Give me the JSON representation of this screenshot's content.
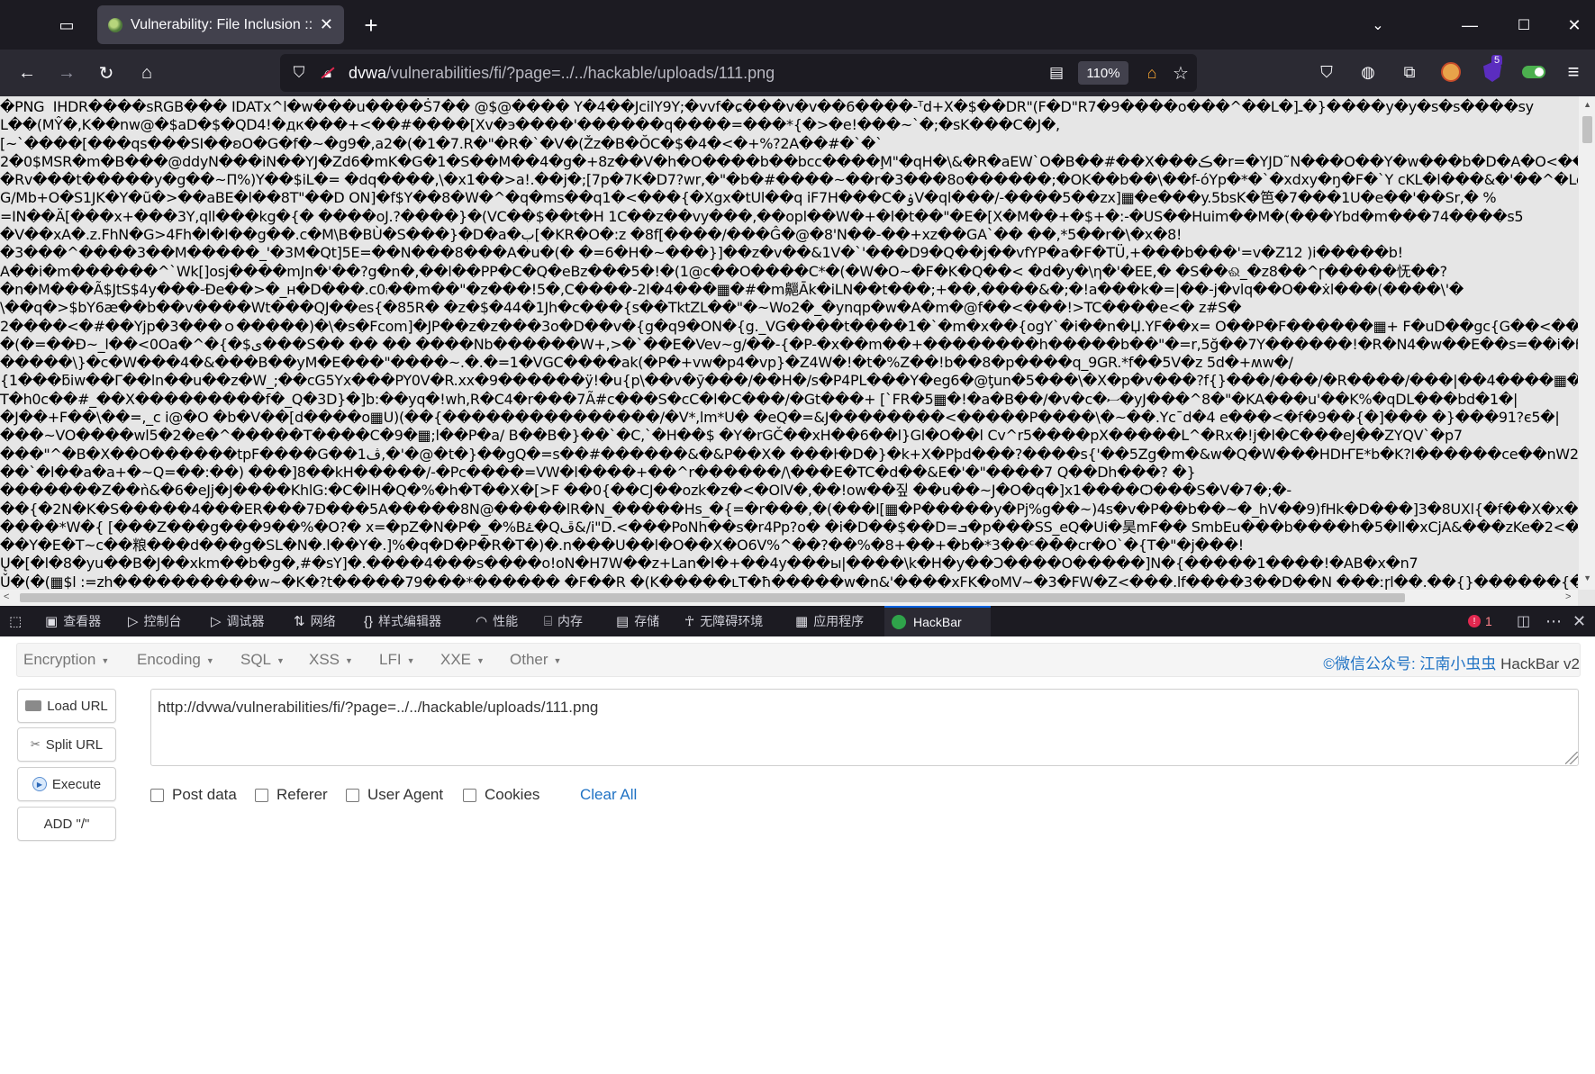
{
  "tab": {
    "title": "Vulnerability: File Inclusion ::",
    "close": "✕",
    "new_tab": "+"
  },
  "window": {
    "overflow": "⌄",
    "minimize": "—",
    "maximize": "☐",
    "close": "✕"
  },
  "nav": {
    "url_host": "dvwa",
    "url_path": "/vulnerabilities/fi/?page=../../hackable/uploads/111.png",
    "zoom": "110%",
    "ublock_badge": "5"
  },
  "icons": {
    "tab_list": "tab-list-icon",
    "back": "back-arrow-icon",
    "forward": "forward-arrow-icon",
    "reload": "reload-icon",
    "home": "home-icon",
    "shield": "tracking-shield-icon",
    "lock": "insecure-lock-icon",
    "reader": "reader-view-icon",
    "star": "bookmark-star-icon",
    "pocket": "pocket-icon",
    "globe": "globe-icon",
    "extensions": "puzzle-icon",
    "menu": "hamburger-menu-icon"
  },
  "page_lines": [
    "�PNG  IHDR����sRGB��� IDATx^l�w���u����Ṡ7�� @$@���� Y�4��JcilY9Y;�vvf�ɕ���v�v��6����-ᵀd+X�$��DR\"(F�D\"R7�9����o���^��L�]ـ�}����y�y�s�s����sy",
    "L��(MŶ�,K��nw@�$aD�$�QD4!�дк���+<��#����[Xv�э����'������q����=���*{�>�e!���~`�;�sK���C�J�,",
    "[~`����[���qs���SI��ʚO�G�f�~�g9�,a2�(�1�7.R�\"�R�`�V�(Žz�B�ŎC�$�4�<�+%?2A��#�`�`",
    "2�0$MSR�m�B���@ddyN���iN��YJ�Zd6�mK�G�1�S��M��4�g�+8z��V�h�O����b��bcc����M̧\"�qH�\\&�R�aEW`O�B��#��X���ڪ�r=�YJD˜N���O��Y�w���b�D�A�O<��p~i���",
    "�Rv���t�����y�g��~Π%)Y��$iL�= �dq����,\\�x1��>a!.��j�;[7p�7K�D7?wr,�\"�b�#����~��r�3���8o������;�OK��b��\\��f-óYp�*�`�xdxy�ŋ�F�`Y cKL�l���&�'��^�Le}",
    "G/Mb+O�S1JK�Y�ũ�>��aBE�l��8T\"��D ON]�f$Y��8�W�^�q�ms��q1�<���{�Xgx�tUl��q iF7H���C�ۏV�ql���/-����5��zx]▦�e���y.5ƅsK�笆�7���1U�e��'��Sr,� %",
    "=IN��Ä[���x+���3Y,qll���kg�{� ����oJ.?����}�(VC��$��t�H 1C��z��vy���,��opl��W�+�l�t��\"�E�[X�M��+�$+�:-�US��Huim��M�(���Ybd�m���74����s5",
    "�V��xA�.z.FhN�G>4Fh�l�l��g��.c�M\\B�BÙ�S���}�D�a�ب[�KR�O�:z �8f[����/���Ĝ�@�8'N��-��+xz��GA`�� ��,*5��r�\\�x�8!",
    "�3���^����3��M�����_'�3M�Qt]5E=��N���8���A�u�(� �=6�H�~���}]��z�v��&1V�`'���D9�Q��j��vfYP�a�F�TÜ,+���b���'=v�Z12 )i�����b!",
    "A��i�m������^`Wk[]osj����mJn�'��?g�n�,��l��PP�C�Q�eBz���5�!�(1@c��O����C*�(�W�O~�F�K�Q��< �d�y�\\η�'�EE,� �S��ଈ_�z8��^ɼ�����怃��?",
    "�n�M���Ã$JtS$4y���-Ðe��>�_ʜ�D���.c0ᵢ��m��\"�z���!5�,C����-2l�4���▦�#�m齆Āk�iLN��t���;+��,����&�;�!a���k�=|��-j�vlq��O��ẋl���(����\\'�",
    "\\��q�>$bY6æ��b��v����Wt���QJ��es{�85R� �z�$�44�1Jh�c���{s��TktZL��\"�~Wo2�_�ynqp�w�A�m�@f��<���!>TC����e<� z#S�",
    "2����<�#��Yjp�3���ｏ�����)�\\�s�Fcom]�JP��z�z���3o�D��v�{g�q9�ON�{g._VG����t����1�`�m�x��{ogY`�i��n�Џ.YF��x= O��P�F������▦+ F�uD��gc{G��<��9�AH",
    "�(�=��Ð~_l��<0Oa�^�{�$ى���S�� �� �� ����Nb������W+,>�`��E�Vev~g/��-{�P-�x��m��+��������h�����b��\"�=r,5ğ��7Y������!�R�N4�w��E��s=��i�ɦ�|",
    "�����\\}�c�W���4�&���B��yM�E���\"����~.�.�=1�VGC����ak(�P�+vw�p4�vp}�Z4W�!�t�%Z��!b��8�p����q_9GR.*f��5V�z 5d�+ʍw�/",
    "{1���ƃiw��Γ��ln��u��z�W_;��cG5Yx���PY0V�R.xx�9������ӱ!�u{p\\��v�ӯ���/��H�/s�P4PL���Y�eg6�@ƫun�5���\\�X�p�v���?f{}���/���/�R����/���|��4����▦�(N$d��",
    "T�h0c��#_��X���������f�_Q�3D}�]b:��yq�!wh,R�C4�r���7Ã#c���S�cC�l�C���/�Gt���+ [`FR�5▦�!�a�B��/�v�c�ސ�yJ���^8�\"�KA���u'��K%�qDL���bd�1�|",
    "�J��+F��\\��=,_c i@�O �b�V��[d����o▦U)(��{���������������/�V*,lm*U� �eQ�=&J��������<�����P����\\�~��.Ycˉd�4 e���<�f�9��{�]��� �}���91?є5�|",
    "���~VO����wl5�2�e�^�����T����C�9�▦;l��P�a/ B��B�}��`�C,`�H��$ �Y�rGČ��xH��6��l}Gl�O��l Cv^r5����pX�����L^�Rx�!j�l�C���eJ��ZYQV`�p7",
    "���\"^�B�X��O������tpF����G��1ڤ,�'�@�t�}��gQ�=s��#������&�&P��X� ���ŀ�D�}�k+X�Pþd���?����s{'��5Zg�m�&w�Q�W���HDҤE*b�K?l������ce��nW2��",
    "��`�l��a�a+�~Q=��:��) ���]8��kH�����/-�Pc����=VW�l����+��^r������/\\���E�TC�d��&E�'�\"����7 Q��Dh���? �}",
    "�������Z��ǹ&�6�eJj�J����KhlG:�C�lH�Q�%�h�T��X�[>F ��0{��CJ��ozk�z�<�OlV�,��!ow��짚 ��u��~J�O�q�]x1����Ѻ���S�V�7�;�-",
    "��{�2N�K�S�����4���ER���7Ð���5A�����8N@�����lR�N_�����Hs_�{=�r���,�(���l[▦�P�����y�Pj%g��~)4s�v�P��b��~�_hV��9)fHk�D���]3�8UXl{�f��X�x�F��9ڇ|",
    "����*W�{ [���Z���g���9��%�O?� x=�pZ�N�P�_�%Bۓ�Qڦ&/i\"D.<���PoNh��s�r4Pp?o� �i�D��$��D=ܒ�p���SS_eQ�Ui�昊mF�� SmbEu���b����h�5�ll�xCjA&���zKe�2<�L$\\�� e5|",
    "��Y�E�T~c��粮���d���g�SL�N�.l��Y�.]%�q�D�P�R�T�)�.n���U��l�O��X�O6V%^��?��%�8+��+�b�*3��ᶜ���cr�O`�{T�\"�j���!",
    "Ų�[�l�8�yu��B�J��xkm��b�g�,#�sY]�.����4���s����o!oN�H7W��z+Lan�l�+��4y���ы|����\\k�H�y��Ɔ����O�����]N�{�����1����!�AB�x�n7",
    "Ǔ�(�(▦$l :=zh����������w~�K�?t�����79���*������ �F��R �(K�����ʟT�ħ�����w�n&'����xFK�oMV~�3�FW�Z<���.lf����3��D��N ���ːɼl��.��{}������{�Y�l"
  ],
  "devtools": {
    "inspector": "查看器",
    "console": "控制台",
    "debugger": "调试器",
    "network": "网络",
    "style_editor": "样式编辑器",
    "performance": "性能",
    "memory": "内存",
    "storage": "存储",
    "accessibility": "无障碍环境",
    "application": "应用程序",
    "hackbar": "HackBar",
    "error_count": "1"
  },
  "hackbar": {
    "menu": {
      "encryption": "Encryption",
      "encoding": "Encoding",
      "sql": "SQL",
      "xss": "XSS",
      "lfi": "LFI",
      "xxe": "XXE",
      "other": "Other"
    },
    "credit_prefix": "©微信公众号: 江南小虫虫",
    "credit_suffix": " HackBar v2",
    "buttons": {
      "load_url": "Load URL",
      "split_url": "Split URL",
      "execute": "Execute",
      "add_slash": "ADD \"/\""
    },
    "url_value": "http://dvwa/vulnerabilities/fi/?page=../../hackable/uploads/111.png",
    "checkboxes": {
      "post_data": "Post data",
      "referer": "Referer",
      "user_agent": "User Agent",
      "cookies": "Cookies"
    },
    "clear_all": "Clear All"
  }
}
